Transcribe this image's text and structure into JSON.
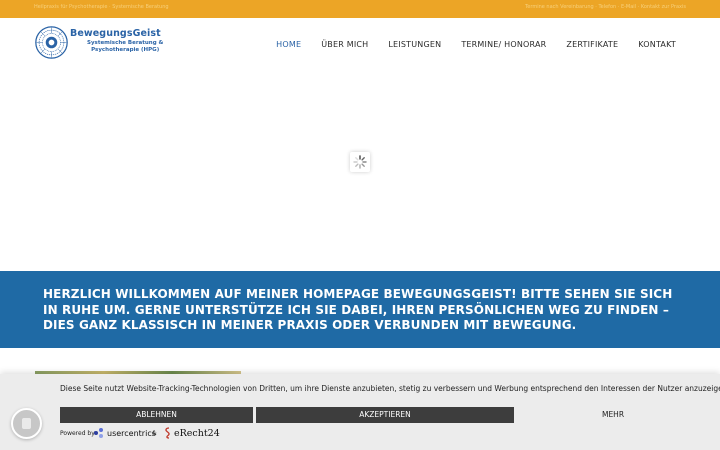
{
  "topbar": {
    "left_text": "Heilpraxis für Psychotherapie · Systemische Beratung",
    "right_text": "Termine nach Vereinbarung · Telefon · E-Mail · Kontakt zur Praxis"
  },
  "logo": {
    "name": "BewegungsGeist",
    "subtitle_line1": "Systemische Beratung &",
    "subtitle_line2": "Psychotherapie (HPG)"
  },
  "nav": {
    "items": [
      {
        "label": "HOME",
        "active": true
      },
      {
        "label": "ÜBER MICH",
        "active": false
      },
      {
        "label": "LEISTUNGEN",
        "active": false
      },
      {
        "label": "TERMINE/ HONORAR",
        "active": false
      },
      {
        "label": "ZERTIFIKATE",
        "active": false
      },
      {
        "label": "KONTAKT",
        "active": false
      }
    ]
  },
  "banner": {
    "text": "Herzlich Willkommen auf meiner Homepage BewegungsGeist! Bitte sehen Sie sich in Ruhe um. Gerne unterstütze ich Sie dabei, Ihren persönlichen Weg zu finden – dies ganz klassisch in meiner Praxis oder verbunden mit Bewegung."
  },
  "cookie": {
    "message": "Diese Seite nutzt Website-Tracking-Technologien von Dritten, um ihre Dienste anzubieten, stetig zu verbessern und Werbung entsprechend den Interessen der Nutzer anzuzeigen.",
    "decline_label": "ABLEHNEN",
    "accept_label": "AKZEPTIEREN",
    "more_label": "MEHR",
    "powered_by": "Powered by",
    "usercentrics": "usercentrics",
    "ampersand": "&",
    "erecht": "eRecht24"
  },
  "colors": {
    "topbar": "#eca526",
    "brand_blue": "#2a63a6",
    "banner": "#1f6aa5",
    "cookie_bg": "#ececec",
    "button_dark": "#3d3d3d"
  },
  "icons": {
    "logo": "sun-mandala-icon",
    "spinner": "loading-spinner-icon",
    "privacy": "privacy-settings-icon"
  }
}
